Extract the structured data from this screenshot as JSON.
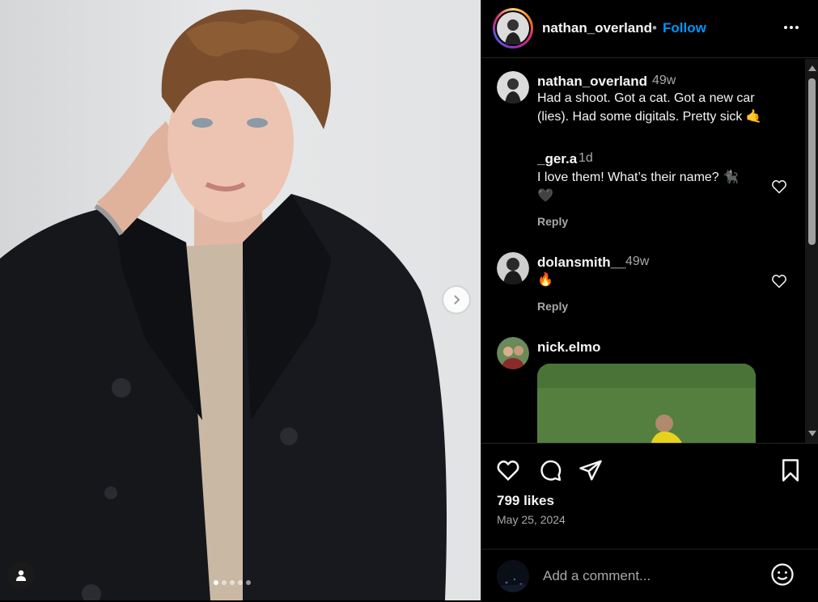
{
  "post": {
    "author": "nathan_overland",
    "separator": "•",
    "follow_label": "Follow",
    "more_icon": "more-horizontal-icon",
    "carousel": {
      "slides": 5,
      "active_index": 0
    }
  },
  "comments": [
    {
      "user": "nathan_overland",
      "time": "49w",
      "text": "Had a shoot. Got a cat. Got a new car (lies). Had some digitals. Pretty sick 🤙"
    },
    {
      "user": "_ger.a",
      "time": "1d",
      "text": "I love them! What’s their name? 🐈‍⬛🖤",
      "reply_label": "Reply"
    },
    {
      "user": "dolansmith__",
      "time": "49w",
      "text": "🔥",
      "reply_label": "Reply"
    },
    {
      "user": "nick.elmo",
      "media_icon": "soccer-photo-thumbnail"
    }
  ],
  "actions": {
    "likes": "799 likes",
    "date": "May 25, 2024",
    "add_comment_placeholder": "Add a comment..."
  },
  "colors": {
    "follow": "#0095f6",
    "background": "#000000",
    "muted_text": "#a8a8a8"
  }
}
